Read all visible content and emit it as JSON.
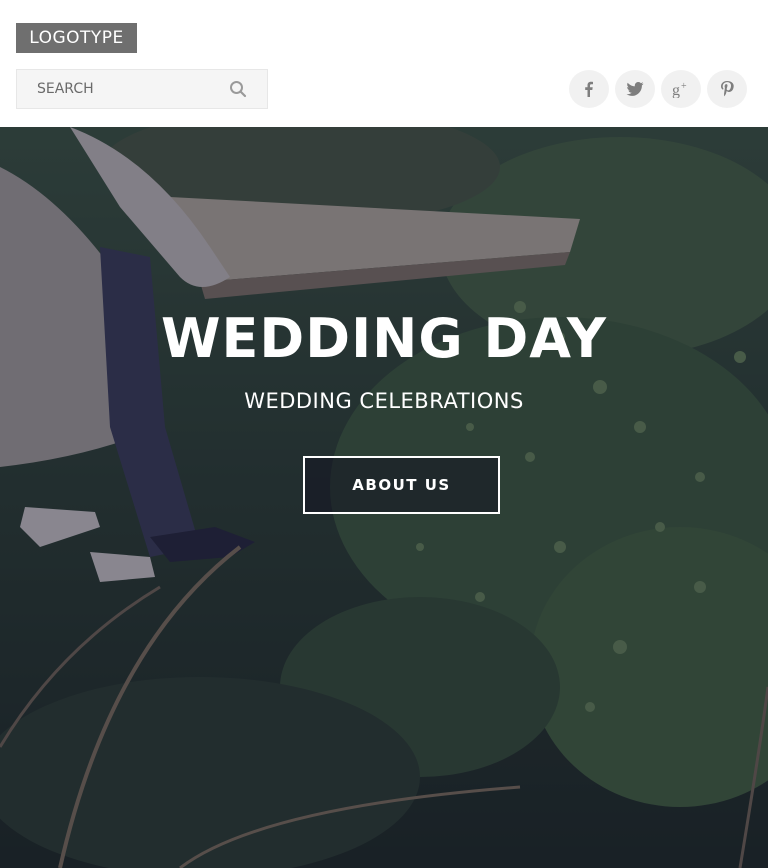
{
  "header": {
    "logo_text": "LOGOTYPE",
    "search": {
      "placeholder": "SEARCH"
    },
    "social_links": [
      {
        "name": "facebook",
        "glyph": "f",
        "icon": "facebook-icon"
      },
      {
        "name": "twitter",
        "glyph": "❧",
        "icon": "twitter-icon"
      },
      {
        "name": "google-plus",
        "glyph": "g+",
        "icon": "google-plus-icon"
      },
      {
        "name": "pinterest",
        "glyph": "p",
        "icon": "pinterest-icon"
      }
    ]
  },
  "hero": {
    "title": "WEDDING DAY",
    "subtitle": "WEDDING CELEBRATIONS",
    "button_label": "ABOUT US",
    "background_description_icon": "wedding-couple-photo"
  },
  "colors": {
    "logo_bg": "#6f6f6f",
    "search_bg": "#f5f5f5",
    "social_bg": "#f1f1f1",
    "overlay": "#191937"
  }
}
